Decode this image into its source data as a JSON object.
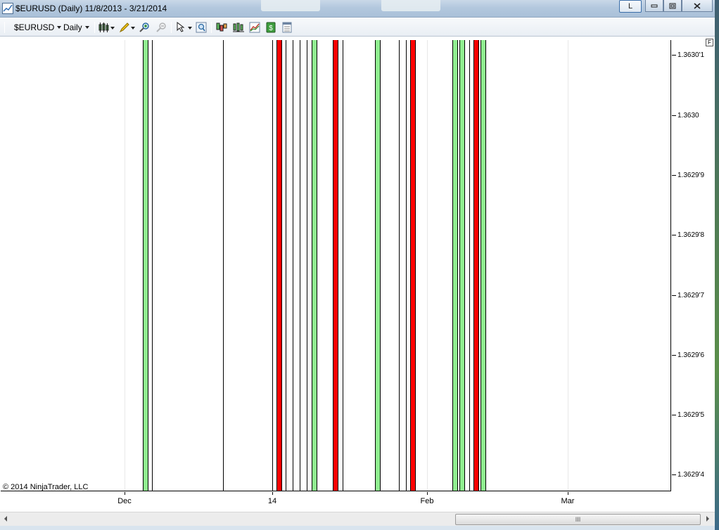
{
  "window": {
    "title": "$EURUSD (Daily)  11/8/2013 - 3/21/2014",
    "layout_button": "L"
  },
  "toolbar": {
    "instrument": "$EURUSD",
    "interval": "Daily",
    "icons": [
      "chart-style-icon",
      "drawing-tools-icon",
      "zoom-in-icon",
      "zoom-out-icon",
      "cursor-icon",
      "magnify-icon",
      "indicators-icon",
      "strategies-icon",
      "chart-trader-icon",
      "dollar-icon",
      "data-box-icon"
    ]
  },
  "chart": {
    "f_button": "F",
    "copyright": "© 2014 NinjaTrader, LLC",
    "y_axis_labels": [
      "1.3630'1",
      "1.3630",
      "1.3629'9",
      "1.3629'8",
      "1.3629'7",
      "1.3629'6",
      "1.3629'5",
      "1.3629'4"
    ],
    "x_axis_labels": [
      "Dec",
      "14",
      "Feb",
      "Mar"
    ],
    "bar_colors": {
      "up": "#90ee90",
      "down": "#ff0000",
      "flat": "#000000"
    }
  },
  "scrollbar": {
    "thumb_label": "III"
  }
}
